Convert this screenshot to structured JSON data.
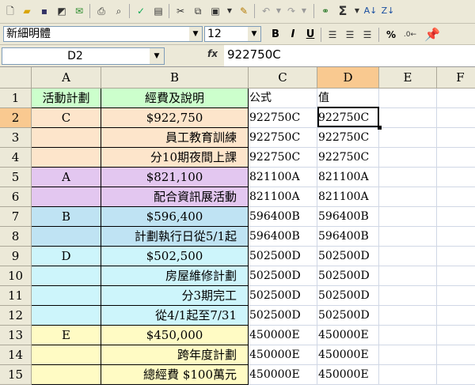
{
  "toolbar": {
    "font_name": "新細明體",
    "font_size": "12",
    "bold": "B",
    "italic": "I",
    "underline": "U",
    "percent": "%",
    "sigma": "Σ"
  },
  "formula_bar": {
    "name_box": "D2",
    "fx_label": "fx",
    "formula": "922750C"
  },
  "sheet": {
    "active_cell": "D2",
    "columns": [
      "A",
      "B",
      "C",
      "D",
      "E",
      "F"
    ],
    "header_row": {
      "A": "活動計劃",
      "B": "經費及說明",
      "C": "公式",
      "D": "值"
    },
    "rows": [
      {
        "num": "2",
        "A": "C",
        "B": "$922,750",
        "C": "922750C",
        "D": "922750C"
      },
      {
        "num": "3",
        "A": "",
        "B": "員工教育訓練",
        "C": "922750C",
        "D": "922750C"
      },
      {
        "num": "4",
        "A": "",
        "B": "分10期夜間上課",
        "C": "922750C",
        "D": "922750C"
      },
      {
        "num": "5",
        "A": "A",
        "B": "$821,100",
        "C": "821100A",
        "D": "821100A"
      },
      {
        "num": "6",
        "A": "",
        "B": "配合資訊展活動",
        "C": "821100A",
        "D": "821100A"
      },
      {
        "num": "7",
        "A": "B",
        "B": "$596,400",
        "C": "596400B",
        "D": "596400B"
      },
      {
        "num": "8",
        "A": "",
        "B": "計劃執行日從5/1起",
        "C": "596400B",
        "D": "596400B"
      },
      {
        "num": "9",
        "A": "D",
        "B": "$502,500",
        "C": "502500D",
        "D": "502500D"
      },
      {
        "num": "10",
        "A": "",
        "B": "房屋維修計劃",
        "C": "502500D",
        "D": "502500D"
      },
      {
        "num": "11",
        "A": "",
        "B": "分3期完工",
        "C": "502500D",
        "D": "502500D"
      },
      {
        "num": "12",
        "A": "",
        "B": "從4/1起至7/31",
        "C": "502500D",
        "D": "502500D"
      },
      {
        "num": "13",
        "A": "E",
        "B": "$450,000",
        "C": "450000E",
        "D": "450000E"
      },
      {
        "num": "14",
        "A": "",
        "B": "跨年度計劃",
        "C": "450000E",
        "D": "450000E"
      },
      {
        "num": "15",
        "A": "",
        "B": "總經費 $100萬元",
        "C": "450000E",
        "D": "450000E"
      }
    ]
  },
  "colors": {
    "header_fill": "#ccffcc",
    "group_C": "#fde5cb",
    "group_A": "#e3c7f0",
    "group_B": "#bfe3f3",
    "group_D": "#cdf5fb",
    "group_E": "#fffbc4",
    "active_header": "#f9c990"
  }
}
